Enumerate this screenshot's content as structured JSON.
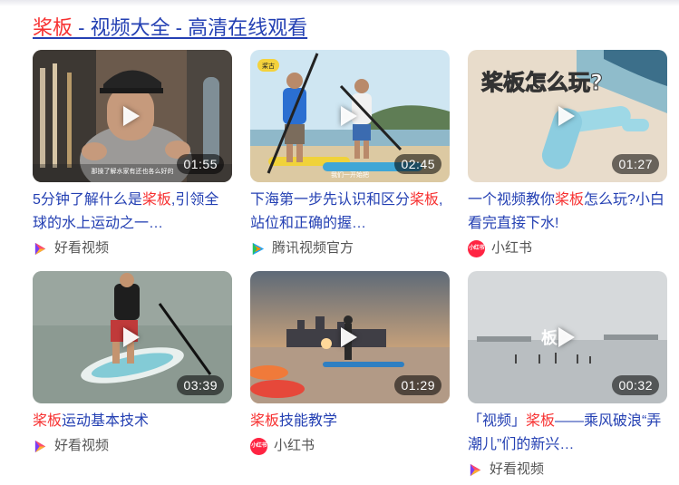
{
  "header": {
    "keyword": "桨板",
    "rest": " - 视频大全 - 高清在线观看"
  },
  "colors": {
    "link": "#2440b3",
    "highlight": "#f73131",
    "xiaohongshu": "#ff2442"
  },
  "videos": [
    {
      "duration": "01:55",
      "title_pre": "5分钟了解什么是",
      "title_hl": "桨板",
      "title_post": ",引领全球的水上运动之一…",
      "source": "好看视频",
      "source_icon": "haokan-icon",
      "thumb_caption": "那操了解水家有还也各么好的"
    },
    {
      "duration": "02:45",
      "title_pre": "下海第一步先认识和区分",
      "title_hl": "桨板",
      "title_post": ",站位和正确的握…",
      "source": "腾讯视频官方",
      "source_icon": "tencent-video-icon",
      "thumb_caption": "我们一开始把",
      "thumb_badge": "桨古"
    },
    {
      "duration": "01:27",
      "title_pre": "一个视频教你",
      "title_hl": "桨板",
      "title_post": "怎么玩?小白看完直接下水!",
      "source": "小红书",
      "source_icon": "xiaohongshu-icon",
      "icon_text": "小红书",
      "thumb_caption": "桨板怎么玩?"
    },
    {
      "duration": "03:39",
      "title_pre": "",
      "title_hl": "桨板",
      "title_post": "运动基本技术",
      "source": "好看视频",
      "source_icon": "haokan-icon"
    },
    {
      "duration": "01:29",
      "title_pre": "",
      "title_hl": "桨板",
      "title_post": "技能教学",
      "source": "小红书",
      "source_icon": "xiaohongshu-icon",
      "icon_text": "小红书"
    },
    {
      "duration": "00:32",
      "title_pre": "「视频」",
      "title_hl": "桨板",
      "title_post": "——乘风破浪“弄潮儿”们的新兴…",
      "source": "好看视频",
      "source_icon": "haokan-icon",
      "thumb_caption": "板"
    }
  ]
}
